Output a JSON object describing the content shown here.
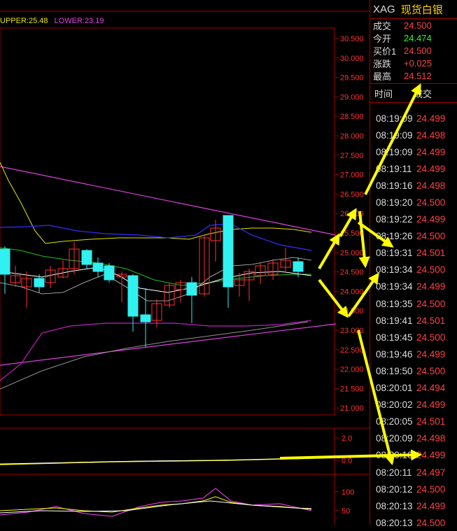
{
  "indicator_legend": {
    "upper": "UPPER:25.48",
    "lower": "LOWER:23.19"
  },
  "price_axis": {
    "ticks": [
      "30.500",
      "30.000",
      "29.500",
      "29.000",
      "28.500",
      "28.000",
      "27.500",
      "27.000",
      "26.500",
      "26.000",
      "25.500",
      "25.000",
      "24.500",
      "24.000",
      "23.500",
      "23.000",
      "22.500",
      "22.000",
      "21.500",
      "21.000"
    ]
  },
  "macd_axis": {
    "ticks": [
      "2.0",
      "0.0"
    ]
  },
  "kdj_axis": {
    "ticks": [
      "100",
      "50"
    ]
  },
  "quote": {
    "code": "XAG",
    "name": "现货白银",
    "rows": [
      {
        "label": "成交",
        "value": "24.500",
        "color": "red"
      },
      {
        "label": "今开",
        "value": "24.474",
        "color": "green"
      },
      {
        "label": "买价1",
        "value": "24.500",
        "color": "red"
      },
      {
        "label": "涨跌",
        "value": "+0.025",
        "color": "red"
      },
      {
        "label": "最高",
        "value": "24.512",
        "color": "red"
      }
    ]
  },
  "trade_header": {
    "time": "时间",
    "price": "成交"
  },
  "trades": [
    {
      "time": "08:19:09",
      "price": "24.499",
      "color": "red"
    },
    {
      "time": "08:19:09",
      "price": "24.498",
      "color": "red"
    },
    {
      "time": "08:19:09",
      "price": "24.499",
      "color": "red"
    },
    {
      "time": "08:19:11",
      "price": "24.499",
      "color": "red"
    },
    {
      "time": "08:19:16",
      "price": "24.498",
      "color": "red"
    },
    {
      "time": "08:19:20",
      "price": "24.500",
      "color": "red"
    },
    {
      "time": "08:19:22",
      "price": "24.499",
      "color": "red"
    },
    {
      "time": "08:19:26",
      "price": "24.500",
      "color": "red"
    },
    {
      "time": "08:19:31",
      "price": "24.501",
      "color": "red"
    },
    {
      "time": "08:19:34",
      "price": "24.500",
      "color": "red"
    },
    {
      "time": "08:19:34",
      "price": "24.499",
      "color": "red"
    },
    {
      "time": "08:19:35",
      "price": "24.500",
      "color": "red"
    },
    {
      "time": "08:19:41",
      "price": "24.501",
      "color": "red"
    },
    {
      "time": "08:19:45",
      "price": "24.500",
      "color": "red"
    },
    {
      "time": "08:19:46",
      "price": "24.499",
      "color": "red"
    },
    {
      "time": "08:19:50",
      "price": "24.500",
      "color": "red"
    },
    {
      "time": "08:20:01",
      "price": "24.494",
      "color": "red"
    },
    {
      "time": "08:20:02",
      "price": "24.499",
      "color": "red"
    },
    {
      "time": "08:20:05",
      "price": "24.501",
      "color": "red"
    },
    {
      "time": "08:20:09",
      "price": "24.498",
      "color": "red"
    },
    {
      "time": "08:20:10",
      "price": "24.499",
      "color": "red"
    },
    {
      "time": "08:20:11",
      "price": "24.497",
      "color": "red"
    },
    {
      "time": "08:20:12",
      "price": "24.500",
      "color": "red"
    },
    {
      "time": "08:20:13",
      "price": "24.499",
      "color": "red"
    },
    {
      "time": "08:20:13",
      "price": "24.500",
      "color": "red"
    }
  ],
  "colors": {
    "up": "#ff3030",
    "down": "#30f0f0",
    "grid": "#a00000",
    "arrow": "#ffff00"
  }
}
